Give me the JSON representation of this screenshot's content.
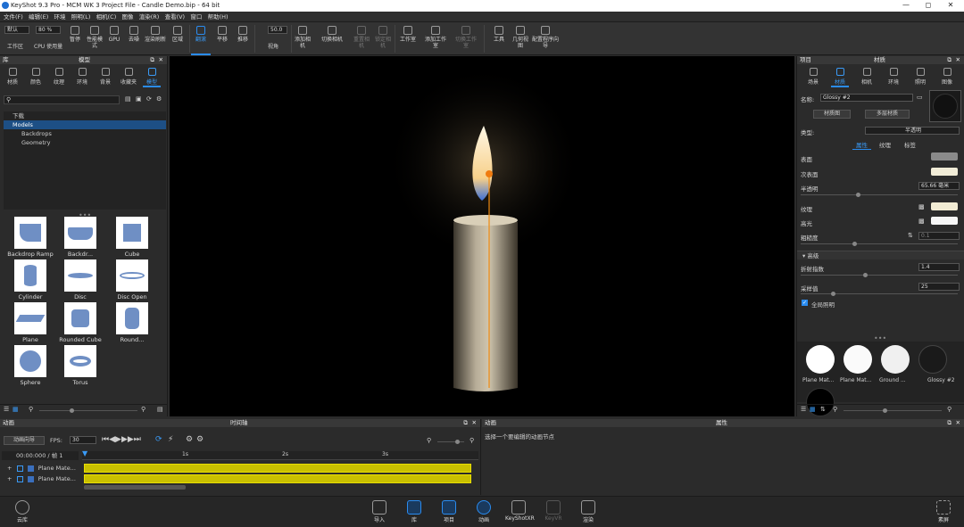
{
  "title_bar": {
    "text": "KeyShot 9.3 Pro  - MCM WK 3 Project File - Candle Demo.bip  - 64 bit",
    "minimize": "—",
    "maximize": "◻",
    "close": "✕"
  },
  "menu": [
    "文件(F)",
    "编辑(E)",
    "环境",
    "照明(L)",
    "相机(C)",
    "图像",
    "渲染(R)",
    "查看(V)",
    "窗口",
    "帮助(H)"
  ],
  "ribbon": {
    "workspace_value": "默认",
    "workspace_label": "工作区",
    "cpu_value": "80 %",
    "cpu_label": "CPU 使用量",
    "buttons": [
      "暂停",
      "性能模式",
      "GPU",
      "去噪",
      "渲染刷新",
      "区域",
      "翻滚",
      "平移",
      "推移"
    ],
    "fov_value": "50.0",
    "fov_label": "视角",
    "buttons2": [
      "添加相机",
      "切换相机",
      "重置相机",
      "锁定相机",
      "工作室",
      "添加工作室",
      "切换工作室",
      "工具",
      "几何视图",
      "配置程序向导"
    ]
  },
  "library": {
    "header": "库",
    "subheader": "模型",
    "tabs": [
      "材质",
      "颜色",
      "纹理",
      "环境",
      "背景",
      "收藏夹",
      "模型"
    ],
    "active_tab": "模型",
    "tree": [
      "下载",
      "Models",
      "Backdrops",
      "Geometry"
    ],
    "models": [
      "Backdrop Ramp",
      "Backdr...",
      "Cube",
      "Cylinder",
      "Disc",
      "Disc Open",
      "Plane",
      "Rounded Cube",
      "Round...",
      "Sphere",
      "Torus"
    ]
  },
  "right_panel": {
    "header_left": "项目",
    "header_center": "材质",
    "tabs": [
      "场景",
      "材质",
      "相机",
      "环境",
      "照明",
      "图像"
    ],
    "active_tab": "材质",
    "name_label": "名称:",
    "name_value": "Glossy #2",
    "btn_material_graph": "材质图",
    "btn_multi_layer": "多层材质",
    "type_label": "类型:",
    "type_value": "半透明",
    "subtabs": [
      "属性",
      "纹理",
      "标签"
    ],
    "props": {
      "surface": "表面",
      "subsurface": "次表面",
      "translucency": "半透明",
      "translucency_value": "65.66 毫米",
      "texture": "纹理",
      "specular": "高光",
      "roughness": "粗糙度",
      "roughness_value": "0.1",
      "advanced": "高级",
      "refractive_index": "折射指数",
      "refractive_value": "1.4",
      "samples": "采样值",
      "samples_value": "25",
      "global_illum": "全局照明"
    },
    "colors": {
      "surface": "#8a8a8a",
      "subsurface": "#f1ecd7",
      "texture": "#f2ecd4",
      "specular": "#f6f6f6"
    },
    "materials": [
      "Plane Mat...",
      "Plane Mat...",
      "Ground ...",
      "Glossy #2"
    ]
  },
  "timeline": {
    "header_left": "动画",
    "header_center": "时间轴",
    "wizard": "动画向导",
    "fps_label": "FPS:",
    "fps_value": "30",
    "time_readout": "00:00:000 / 帧 1",
    "ticks": [
      "1s",
      "2s",
      "3s"
    ],
    "tracks": [
      "Plane Mate...",
      "Plane Mate..."
    ]
  },
  "animation_panel": {
    "header_left": "动画",
    "header_center": "属性",
    "hint": "选择一个要编辑的动画节点"
  },
  "bottom_bar": {
    "cloud": "云库",
    "buttons": [
      "导入",
      "库",
      "项目",
      "动画",
      "KeyShotXR",
      "KeyVR",
      "渲染"
    ],
    "active": [
      "库",
      "项目",
      "动画"
    ],
    "right": "素屏"
  }
}
